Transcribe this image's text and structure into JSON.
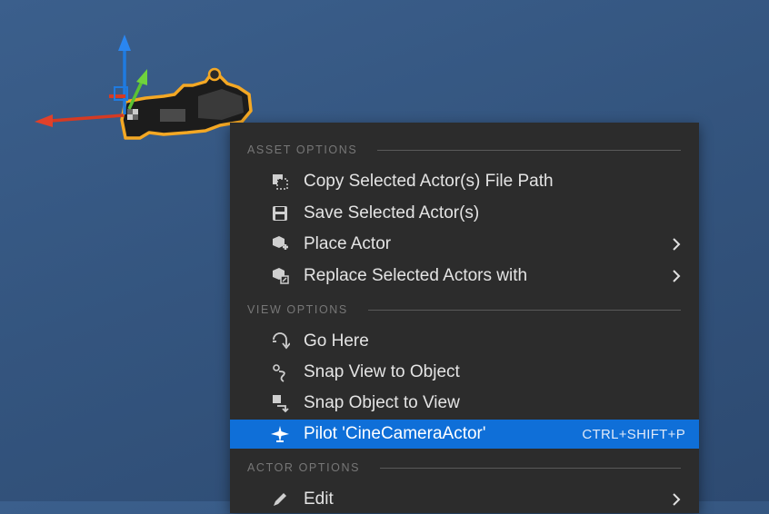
{
  "colors": {
    "viewport_bg": "#34557f",
    "menu_bg": "#2c2c2c",
    "highlight": "#0f6fd8",
    "section_header_text": "#777777",
    "selection_outline": "#f5a623"
  },
  "viewport": {
    "selected_actor_icon": "cine-camera-actor-icon",
    "gizmo_axes": [
      "x-axis-red",
      "y-axis-green",
      "z-axis-blue"
    ]
  },
  "context_menu": {
    "asset_options": {
      "header": "ASSET OPTIONS",
      "items": [
        {
          "label": "Copy Selected Actor(s) File Path",
          "icon": "copy-path-icon",
          "submenu": false
        },
        {
          "label": "Save Selected Actor(s)",
          "icon": "save-icon",
          "submenu": false
        },
        {
          "label": "Place Actor",
          "icon": "place-actor-icon",
          "submenu": true
        },
        {
          "label": "Replace Selected Actors with",
          "icon": "replace-actor-icon",
          "submenu": true
        }
      ]
    },
    "view_options": {
      "header": "VIEW OPTIONS",
      "items": [
        {
          "label": "Go Here",
          "icon": "go-here-icon",
          "submenu": false
        },
        {
          "label": "Snap View to Object",
          "icon": "snap-view-icon",
          "submenu": false
        },
        {
          "label": "Snap Object to View",
          "icon": "snap-object-icon",
          "submenu": false
        },
        {
          "label": "Pilot 'CineCameraActor'",
          "icon": "pilot-icon",
          "submenu": false,
          "shortcut": "CTRL+SHIFT+P",
          "highlighted": true
        }
      ]
    },
    "actor_options": {
      "header": "ACTOR OPTIONS",
      "items": [
        {
          "label": "Edit",
          "icon": "edit-icon",
          "submenu": true
        }
      ]
    }
  }
}
